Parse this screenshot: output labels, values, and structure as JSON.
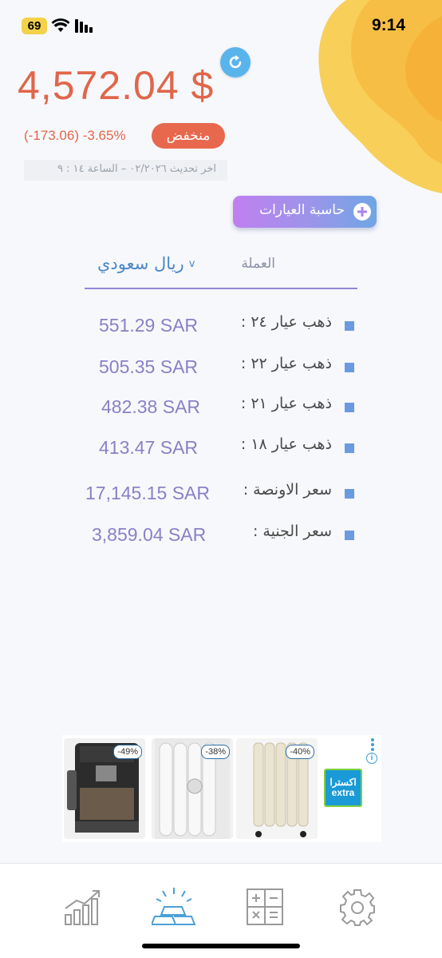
{
  "status_bar": {
    "battery": "69",
    "time": "9:14"
  },
  "header": {
    "price": "4,572.04 $",
    "change_text": "(-173.06)  -3.65%",
    "status_badge": "منخفض",
    "last_updated": "اخر تحديث ٠٢/٢٠٢٦ – الساعة ١٤ : ٩"
  },
  "calculator_button": {
    "label": "حاسبة العيارات"
  },
  "currency": {
    "label": "العملة",
    "selected": "ريال سعودي"
  },
  "prices": [
    {
      "label": "ذهب عيار ٢٤ :",
      "value": "551.29 SAR"
    },
    {
      "label": "ذهب عيار ٢٢ :",
      "value": "505.35 SAR"
    },
    {
      "label": "ذهب عيار ٢١ :",
      "value": "482.38 SAR"
    },
    {
      "label": "ذهب عيار ١٨ :",
      "value": "413.47 SAR"
    },
    {
      "label": "سعر الاونصة :",
      "value": "17,145.15 SAR"
    },
    {
      "label": "سعر الجنية :",
      "value": "3,859.04 SAR"
    }
  ],
  "ad": {
    "discounts": [
      "-49%",
      "-38%",
      "-40%"
    ],
    "brand_logo_text": [
      "اكسترا",
      "extra"
    ]
  },
  "tabs": [
    {
      "icon": "chart-icon",
      "active": false
    },
    {
      "icon": "gold-bars-icon",
      "active": true
    },
    {
      "icon": "calculator-icon",
      "active": false
    },
    {
      "icon": "gear-icon",
      "active": false
    }
  ],
  "colors": {
    "accent": "#e0664a",
    "bullet": "#6a9be0",
    "value": "#8a80c6",
    "active_tab": "#4aa0d8"
  }
}
